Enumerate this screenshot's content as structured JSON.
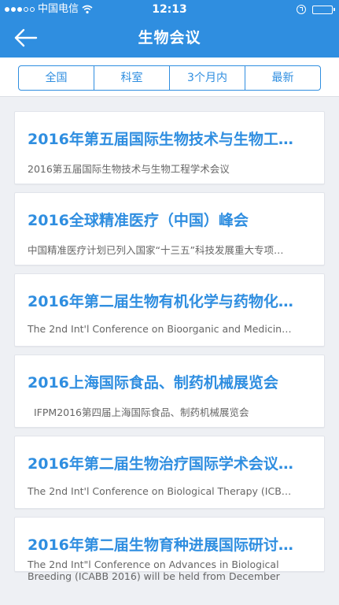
{
  "status_bar": {
    "carrier": "中国电信",
    "time": "12:13"
  },
  "nav": {
    "title": "生物会议"
  },
  "filters": [
    "全国",
    "科室",
    "3个月内",
    "最新"
  ],
  "conferences": [
    {
      "title": "2016年第五届国际生物技术与生物工…",
      "subtitle": "2016第五届国际生物技术与生物工程学术会议"
    },
    {
      "title": "2016全球精准医疗（中国）峰会",
      "subtitle": "中国精准医疗计划已列入国家“十三五”科技发展重大专项…"
    },
    {
      "title": "2016年第二届生物有机化学与药物化…",
      "subtitle": "The 2nd Int'l Conference on Bioorganic and Medicin…"
    },
    {
      "title": "2016上海国际食品、制药机械展览会",
      "subtitle": "IFPM2016第四届上海国际食品、制药机械展览会"
    },
    {
      "title": "2016年第二届生物治疗国际学术会议…",
      "subtitle": "The 2nd Int'l Conference on Biological Therapy (ICB…"
    },
    {
      "title": "2016年第二届生物育种进展国际研讨…",
      "subtitle": "The 2nd Int\"l Conference on Advances in Biological Breeding (ICABB 2016) will be held from December"
    }
  ],
  "colors": {
    "primary": "#2f8ee0",
    "background": "#eef0f4"
  }
}
